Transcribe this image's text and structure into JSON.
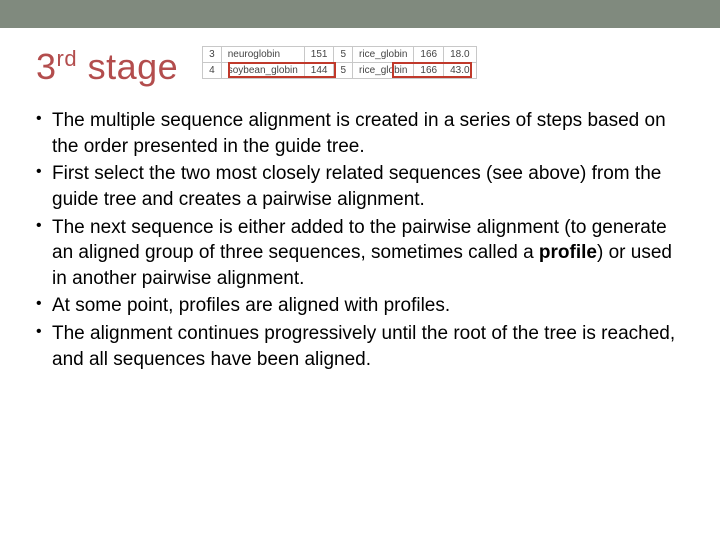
{
  "title_prefix": "3",
  "title_sup": "rd",
  "title_rest": " stage",
  "table": {
    "rows": [
      {
        "idx": "3",
        "name1": "neuroglobin",
        "v1": "151",
        "v2": "5",
        "name2": "rice_globin",
        "v3": "166",
        "v4": "18.0"
      },
      {
        "idx": "4",
        "name1": "soybean_globin",
        "v1": "144",
        "v2": "5",
        "name2": "rice_globin",
        "v3": "166",
        "v4": "43.0"
      }
    ]
  },
  "bullets": [
    {
      "text": "The multiple sequence alignment is created in a series of steps based on the order presented in the guide tree."
    },
    {
      "text": "First select the two most closely related sequences (see above) from the guide tree and creates a pairwise alignment."
    },
    {
      "pre": "The next sequence is either added to the pairwise alignment (to generate an aligned group of three sequences, sometimes called a ",
      "bold": "profile",
      "post": ") or used in another pairwise alignment."
    },
    {
      "text": "At some point, profiles are aligned with profiles."
    },
    {
      "text": "The alignment continues progressively until the root of the tree is reached, and all sequences have been aligned."
    }
  ]
}
